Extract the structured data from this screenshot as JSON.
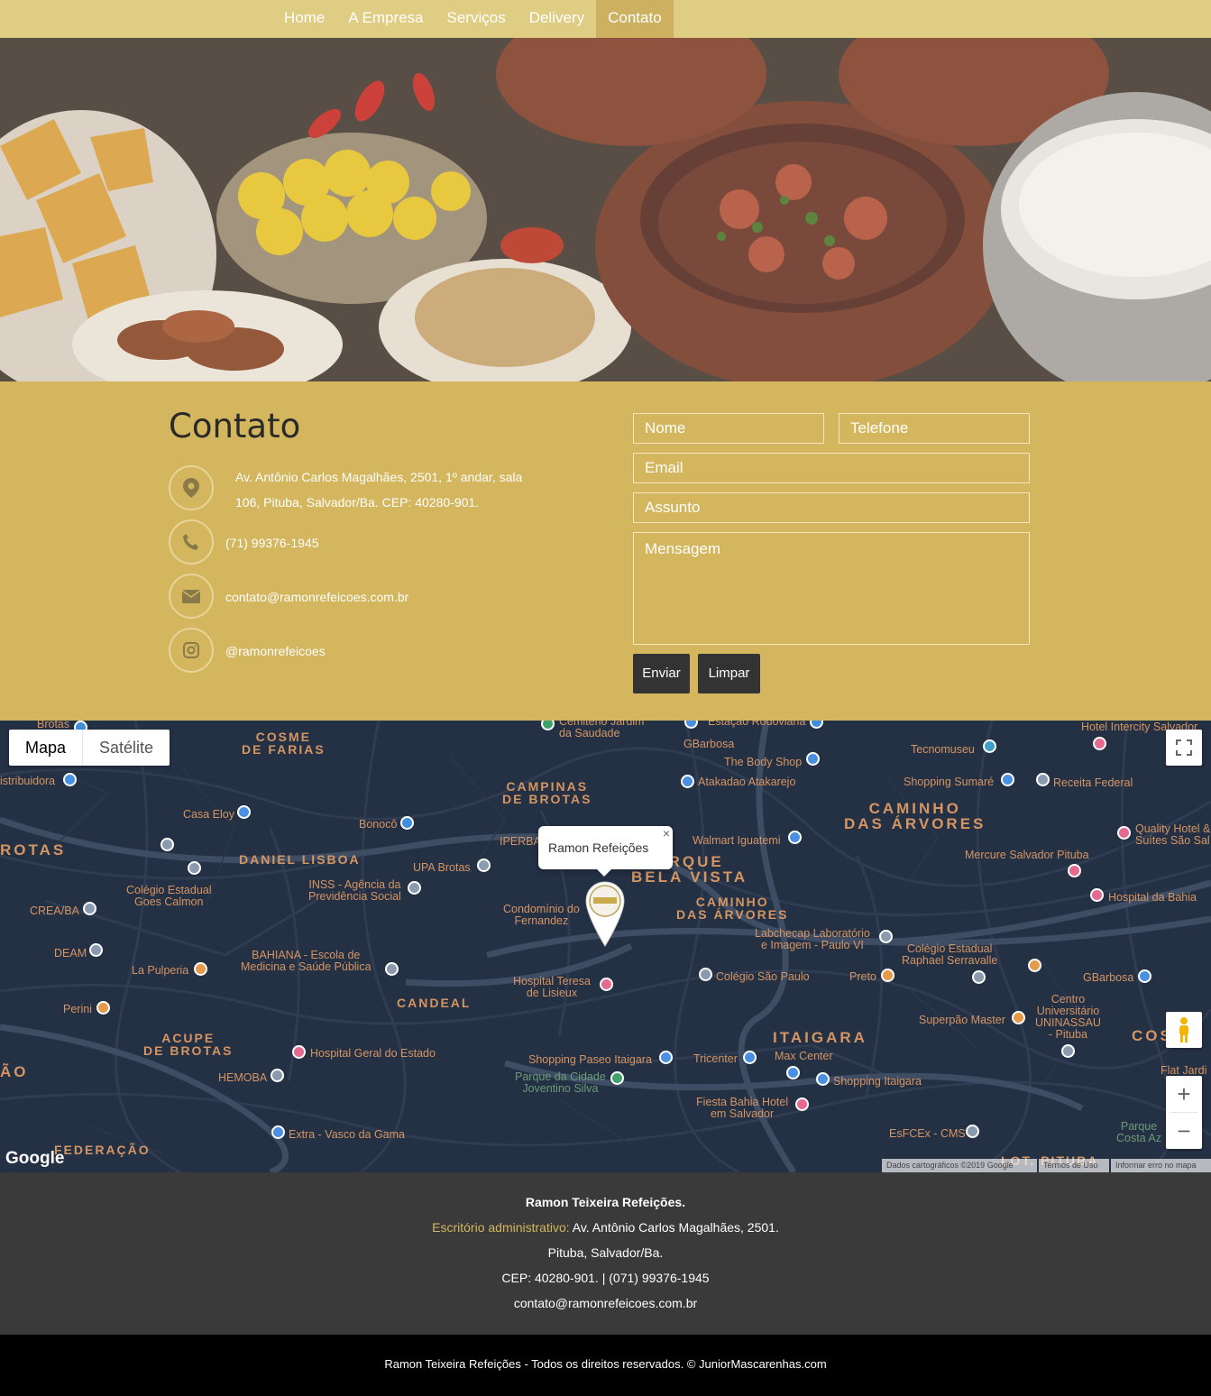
{
  "nav": {
    "items": [
      {
        "label": "Home",
        "active": false
      },
      {
        "label": "A Empresa",
        "active": false
      },
      {
        "label": "Serviços",
        "active": false
      },
      {
        "label": "Delivery",
        "active": false
      },
      {
        "label": "Contato",
        "active": true
      }
    ]
  },
  "contact": {
    "title": "Contato",
    "address_line1": "Av. Antônio Carlos Magalhães, 2501, 1º andar, sala",
    "address_line2": "106, Pituba, Salvador/Ba. CEP: 40280-901.",
    "phone": "(71) 99376-1945",
    "email": "contato@ramonrefeicoes.com.br",
    "instagram": "@ramonrefeicoes",
    "icons": [
      "map-marker-icon",
      "phone-icon",
      "envelope-icon",
      "instagram-icon"
    ]
  },
  "form": {
    "name_placeholder": "Nome",
    "phone_placeholder": "Telefone",
    "email_placeholder": "Email",
    "subject_placeholder": "Assunto",
    "message_placeholder": "Mensagem",
    "submit_label": "Enviar",
    "reset_label": "Limpar"
  },
  "map": {
    "type_map": "Mapa",
    "type_satellite": "Satélite",
    "info_window": "Ramon Refeições",
    "close_symbol": "×",
    "zoom_in": "+",
    "zoom_out": "−",
    "google": "Google",
    "attribution": "Dados cartográficos ©2019 Google",
    "terms": "Termos de Uso",
    "report": "Informar erro no mapa",
    "districts": [
      "COSME DE FARIAS",
      "CAMPINAS DE BROTAS",
      "CAMINHO DAS ÁRVORES",
      "ROTAS",
      "DANIEL LISBOA",
      "PARQUE BELA VISTA",
      "CAMINHO DAS ÁRVORES",
      "CANDEAL",
      "ACUPE DE BROTAS",
      "ITAIGARA",
      "FEDERAÇÃO",
      "LOT. PITUBA",
      "COS",
      "ÃO"
    ],
    "places": [
      "Brotas",
      "Cemitério Jardim da Saudade",
      "Estação Rodoviária",
      "Hotel Intercity Salvador",
      "GBarbosa",
      "The Body Shop",
      "Tecnomuseu",
      "istribuidora",
      "Atakadao Atakarejo",
      "Shopping Sumaré",
      "Receita Federal",
      "Casa Eloy",
      "Bonocô",
      "Quality Hotel & Suítes São Sal",
      "IPERBA",
      "Walmart Iguatemi",
      "Mercure Salvador Pituba",
      "INSS - Agência da Previdência Social",
      "UPA Brotas",
      "Colégio Estadual Goes Calmon",
      "CREA/BA",
      "Hospital da Bahia",
      "Condomínio do Fernandez",
      "Labchecap Laboratório e Imagem - Paulo VI",
      "DEAM",
      "BAHIANA - Escola de Medicina e Saúde Pública",
      "Colégio Estadual Raphael Serravalle",
      "La Pulperia",
      "Hospital Teresa de Lisieux",
      "Colégio São Paulo",
      "Preto",
      "GBarbosa",
      "Perini",
      "Centro Universitário UNINASSAU - Pituba",
      "Superpão Master",
      "Hospital Geral do Estado",
      "Shopping Paseo Itaigara",
      "Tricenter",
      "Max Center",
      "HEMOBA",
      "Parque da Cidade Joventino Silva",
      "Shopping Itaigara",
      "Flat Jardi",
      "Fiesta Bahia Hotel em Salvador",
      "Extra - Vasco da Gama",
      "EsFCEx - CMS",
      "Parque Costa Az"
    ]
  },
  "footer": {
    "company": "Ramon Teixeira Refeições.",
    "office_label": "Escritório administrativo:",
    "office_address": " Av. Antônio Carlos Magalhães, 2501.",
    "city": "Pituba, Salvador/Ba.",
    "cep_phone": "CEP: 40280-901. | (071) 99376-1945",
    "email": "contato@ramonrefeicoes.com.br",
    "copyright": "Ramon Teixeira Refeições - Todos os direitos reservados. © JuniorMascarenhas.com"
  },
  "colors": {
    "nav_bg": "#dfcd84",
    "nav_active": "#cdb160",
    "contact_bg": "#d3b65e",
    "map_bg": "#243044",
    "footer_bg": "#3a3a3a"
  }
}
